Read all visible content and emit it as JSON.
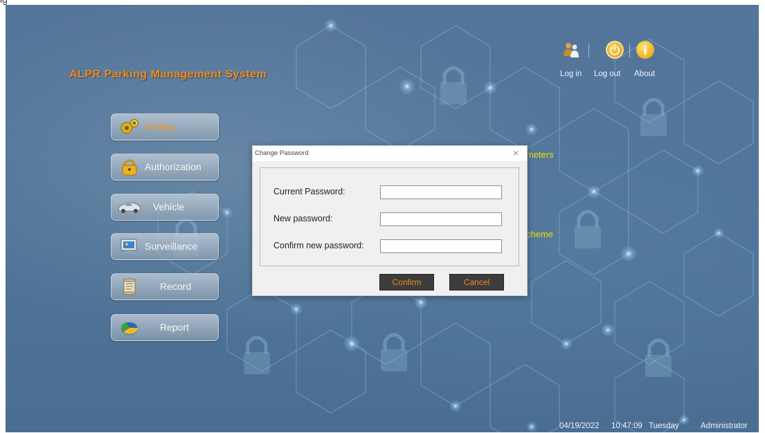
{
  "page_caption": "ig",
  "app": {
    "title": "ALPR Parking Management System"
  },
  "top_actions": [
    {
      "label": "Log in",
      "icon": "users-icon"
    },
    {
      "label": "Log out",
      "icon": "power-icon"
    },
    {
      "label": "About",
      "icon": "info-icon"
    }
  ],
  "menu": [
    {
      "label": "Setting",
      "icon": "gears-icon",
      "active": true
    },
    {
      "label": "Authorization",
      "icon": "padlock-icon"
    },
    {
      "label": "Vehicle",
      "icon": "car-icon"
    },
    {
      "label": "Surveillance",
      "icon": "monitor-icon"
    },
    {
      "label": "Record",
      "icon": "scroll-icon"
    },
    {
      "label": "Report",
      "icon": "pie-chart-icon"
    }
  ],
  "background_items": {
    "item1": "meters",
    "item2": "cheme"
  },
  "dialog": {
    "title": "Change Password",
    "close_glyph": "×",
    "fields": [
      {
        "label": "Current Password:",
        "value": ""
      },
      {
        "label": "New password:",
        "value": ""
      },
      {
        "label": "Confirm new password:",
        "value": ""
      }
    ],
    "confirm_label": "Confirm",
    "cancel_label": "Cancel"
  },
  "status_bar": {
    "date": "04/19/2022",
    "time": "10:47:09",
    "weekday": "Tuesday",
    "user": "Administrator"
  },
  "colors": {
    "accent": "#f08a1c",
    "background": "#4f7398",
    "highlight_text": "#e8e000"
  }
}
